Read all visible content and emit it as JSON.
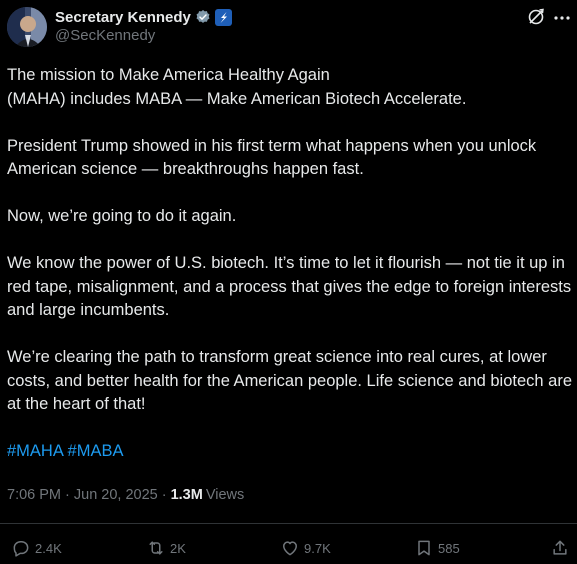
{
  "author": {
    "display_name": "Secretary Kennedy",
    "handle": "@SecKennedy",
    "verified_badge": "verified-badge-icon",
    "gov_badge": "government-affiliation-icon"
  },
  "tweet": {
    "paragraphs": [
      "The mission to Make America Healthy Again\n(MAHA) includes MABA — Make American Biotech Accelerate.",
      "President Trump showed in his first term what happens when you unlock American science — breakthroughs happen fast.",
      "Now, we’re going to do it again.",
      "We know the power of U.S. biotech. It’s time to let it flourish — not tie it up in red tape, misalignment, and a process that gives the edge to foreign interests and large incumbents.",
      "We’re clearing the path to transform great science into real cures, at lower costs, and better health for the American people. Life science and biotech are at the heart of that!"
    ],
    "hashtags": [
      "#MAHA",
      "#MABA"
    ]
  },
  "meta": {
    "timestamp": "7:06 PM · Jun 20, 2025 ·",
    "views_count": "1.3M",
    "views_label": "Views"
  },
  "actions": {
    "replies": "2.4K",
    "reposts": "2K",
    "likes": "9.7K",
    "bookmarks": "585"
  },
  "colors": {
    "background": "#000000",
    "text": "#e7e9ea",
    "muted": "#71767b",
    "accent": "#1d9bf0",
    "divider": "#2f3336"
  }
}
